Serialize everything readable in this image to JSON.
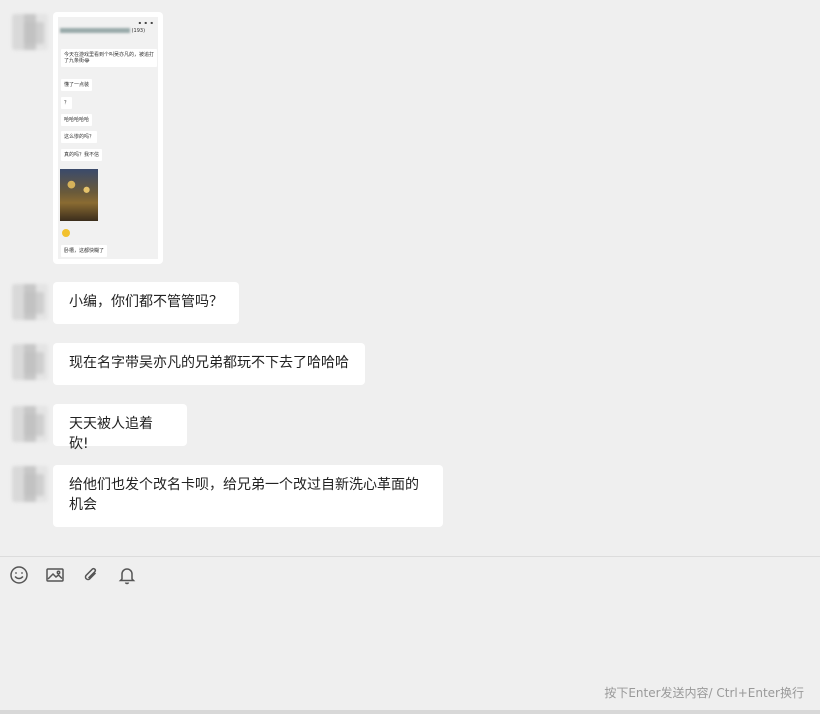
{
  "card": {
    "status_icons": "▪ ▪ ▪",
    "header_count": "(193)",
    "messages": [
      "今天在游戏里看到个叫吴亦凡的，被追打了九条街😂",
      "懂了一点装",
      "？",
      "哈哈哈哈哈",
      "这么惨的吗？",
      "真的吗？我不信",
      "卧槽，这都快糊了"
    ]
  },
  "messages": [
    {
      "text": "小编，你们都不管管吗？"
    },
    {
      "text": "现在名字带吴亦凡的兄弟都玩不下去了哈哈哈"
    },
    {
      "text": "天天被人追着砍!"
    },
    {
      "text": "给他们也发个改名卡呗，给兄弟一个改过自新洗心革面的机会"
    }
  ],
  "toolbar": {
    "icons": [
      "smile-icon",
      "image-icon",
      "paperclip-icon",
      "bell-icon"
    ]
  },
  "input": {
    "hint": "按下Enter发送内容/ Ctrl+Enter换行"
  }
}
